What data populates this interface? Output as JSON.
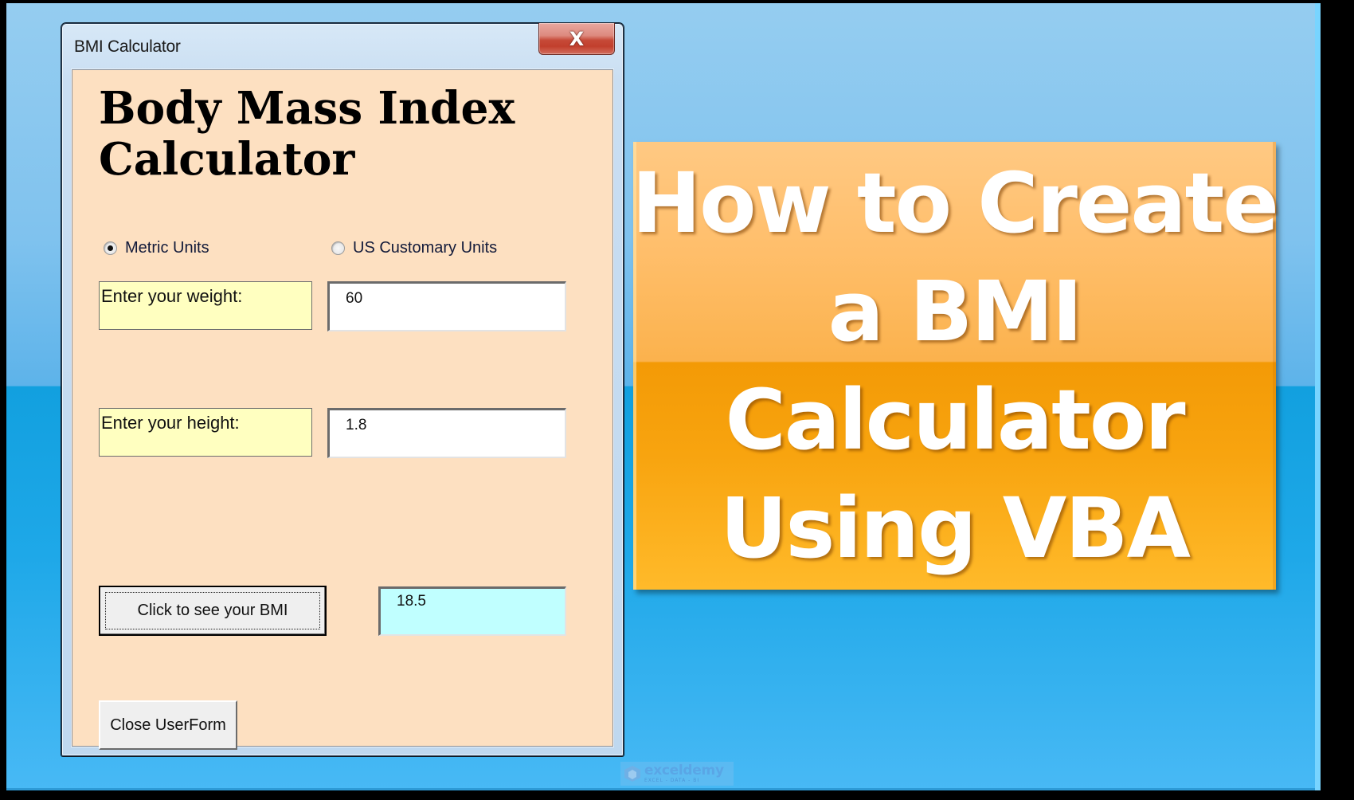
{
  "dialog": {
    "title": "BMI Calculator",
    "close_glyph": "X",
    "heading_line1": "Body Mass Index",
    "heading_line2": "Calculator",
    "units": {
      "options": [
        {
          "label": "Metric Units",
          "checked": true
        },
        {
          "label": "US Customary Units",
          "checked": false
        }
      ]
    },
    "weight": {
      "label": "Enter your weight:",
      "value": "60"
    },
    "height": {
      "label": "Enter your height:",
      "value": "1.8"
    },
    "bmi_button_label": "Click to see your BMI",
    "bmi_result": "18.5",
    "close_form_label": "Close UserForm"
  },
  "banner": {
    "lines": [
      "How to Create",
      "a BMI",
      "Calculator",
      "Using VBA"
    ]
  },
  "watermark": {
    "brand": "exceldemy",
    "tagline": "EXCEL - DATA - BI"
  },
  "colors": {
    "pane_bg": "#fde0c1",
    "label_bg": "#ffffc0",
    "result_bg": "#c0ffff",
    "banner_orange": "#f39a06",
    "desktop_blue": "#1ea8e8"
  }
}
